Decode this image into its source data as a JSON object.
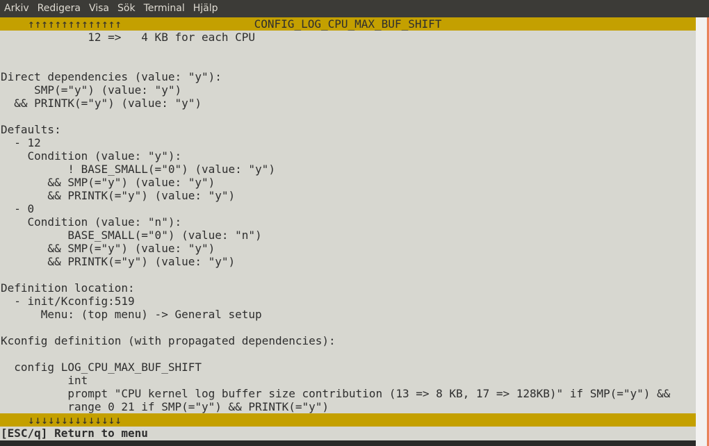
{
  "menubar": {
    "items": [
      "Arkiv",
      "Redigera",
      "Visa",
      "Sök",
      "Terminal",
      "Hjälp"
    ]
  },
  "terminal": {
    "title": "CONFIG_LOG_CPU_MAX_BUF_SHIFT",
    "scroll_up_indicator": "↑↑↑↑↑↑↑↑↑↑↑↑↑↑",
    "scroll_down_indicator": "↓↓↓↓↓↓↓↓↓↓↓↓↓↓",
    "lines": [
      "             12 =>   4 KB for each CPU",
      "",
      "",
      "Direct dependencies (value: \"y\"):",
      "     SMP(=\"y\") (value: \"y\")",
      "  && PRINTK(=\"y\") (value: \"y\")",
      "",
      "Defaults:",
      "  - 12",
      "    Condition (value: \"y\"):",
      "          ! BASE_SMALL(=\"0\") (value: \"y\")",
      "       && SMP(=\"y\") (value: \"y\")",
      "       && PRINTK(=\"y\") (value: \"y\")",
      "  - 0",
      "    Condition (value: \"n\"):",
      "          BASE_SMALL(=\"0\") (value: \"n\")",
      "       && SMP(=\"y\") (value: \"y\")",
      "       && PRINTK(=\"y\") (value: \"y\")",
      "",
      "Definition location:",
      "  - init/Kconfig:519",
      "      Menu: (top menu) -> General setup",
      "",
      "Kconfig definition (with propagated dependencies):",
      "",
      "  config LOG_CPU_MAX_BUF_SHIFT",
      "          int",
      "          prompt \"CPU kernel log buffer size contribution (13 => 8 KB, 17 => 128KB)\" if SMP(=\"y\") &&",
      "          range 0 21 if SMP(=\"y\") && PRINTK(=\"y\")"
    ],
    "status": "[ESC/q] Return to menu"
  },
  "colors": {
    "terminal_bg": "#d7d7d0",
    "bar_bg": "#c4a000",
    "text": "#2e2e2e",
    "menubar_bg": "#3c3b37",
    "menubar_text": "#dfdbd2"
  }
}
